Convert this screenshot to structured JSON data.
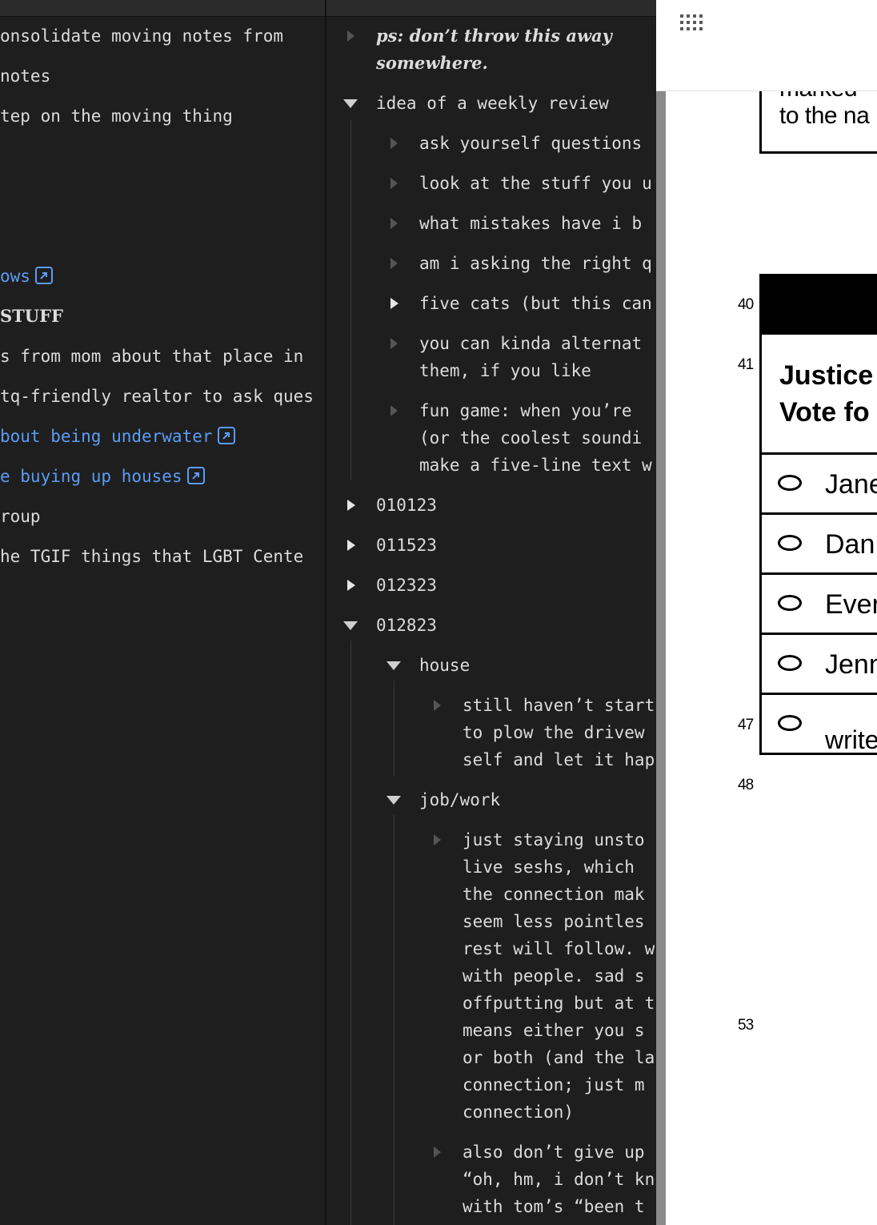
{
  "left_pane": {
    "lines": [
      {
        "text": "onsolidate moving notes from",
        "style": "plain"
      },
      {
        "text": "notes",
        "style": "plain"
      },
      {
        "text": "tep on the moving thing",
        "style": "plain"
      },
      {
        "text": "ows",
        "style": "link"
      },
      {
        "text": "STUFF",
        "style": "bold"
      },
      {
        "text": "s from mom about that place in",
        "style": "plain"
      },
      {
        "text": "tq-friendly realtor to ask ques",
        "style": "plain"
      },
      {
        "text": "bout being underwater",
        "style": "link"
      },
      {
        "text": "e buying up houses",
        "style": "link"
      },
      {
        "text": "roup",
        "style": "plain"
      },
      {
        "text": "he TGIF things that LGBT Cente",
        "style": "plain"
      }
    ],
    "external_link_icon": "external-link-icon"
  },
  "middle_pane": {
    "nodes": [
      {
        "lines": [
          "ps: don’t throw this away ",
          "somewhere."
        ],
        "arrow": "collapsed-dim",
        "italic": true
      },
      {
        "lines": [
          "idea of a weekly review"
        ],
        "arrow": "expanded"
      },
      {
        "lines": [
          "ask yourself questions"
        ],
        "arrow": "collapsed-dim"
      },
      {
        "lines": [
          "look at the stuff you u"
        ],
        "arrow": "collapsed-dim"
      },
      {
        "lines": [
          "what mistakes have i b"
        ],
        "arrow": "collapsed-dim"
      },
      {
        "lines": [
          "am i asking the right q"
        ],
        "arrow": "collapsed-dim"
      },
      {
        "lines": [
          "five cats (but this can"
        ],
        "arrow": "collapsed"
      },
      {
        "lines": [
          "you can kinda alternat",
          "them, if you like"
        ],
        "arrow": "collapsed-dim"
      },
      {
        "lines": [
          "fun game: when you’re ",
          "(or the coolest soundi",
          "make a five-line text w"
        ],
        "arrow": "collapsed-dim"
      },
      {
        "lines": [
          "010123"
        ],
        "arrow": "collapsed"
      },
      {
        "lines": [
          "011523"
        ],
        "arrow": "collapsed"
      },
      {
        "lines": [
          "012323"
        ],
        "arrow": "collapsed"
      },
      {
        "lines": [
          "012823"
        ],
        "arrow": "expanded"
      },
      {
        "lines": [
          "house"
        ],
        "arrow": "expanded"
      },
      {
        "lines": [
          "still haven’t start",
          "to plow the drivew",
          "self and let it hap"
        ],
        "arrow": "collapsed-dim"
      },
      {
        "lines": [
          "job/work"
        ],
        "arrow": "expanded"
      },
      {
        "lines": [
          "just staying unsto",
          "live seshs, which ",
          "the connection mak",
          "seem less pointles",
          "rest will follow. w",
          "with people. sad s",
          "offputting but at t",
          "means either you s",
          "or both (and the la",
          "connection; just m",
          "connection)"
        ],
        "arrow": "collapsed-dim"
      },
      {
        "lines": [
          "also don’t give up",
          "“oh, hm, i don’t kn",
          "with tom’s “been t"
        ],
        "arrow": "collapsed-dim"
      }
    ]
  },
  "doc_viewer": {
    "toolbar_icon": "apps-grid-icon",
    "top_box_lines": [
      "marked",
      "to the na"
    ],
    "row_numbers": [
      "40",
      "41",
      "47",
      "48",
      "53"
    ],
    "contest_title_lines": [
      "Justice",
      "Vote fo"
    ],
    "candidates": [
      "Jane",
      "Dan",
      "Ever",
      "Jenn",
      "write"
    ]
  }
}
